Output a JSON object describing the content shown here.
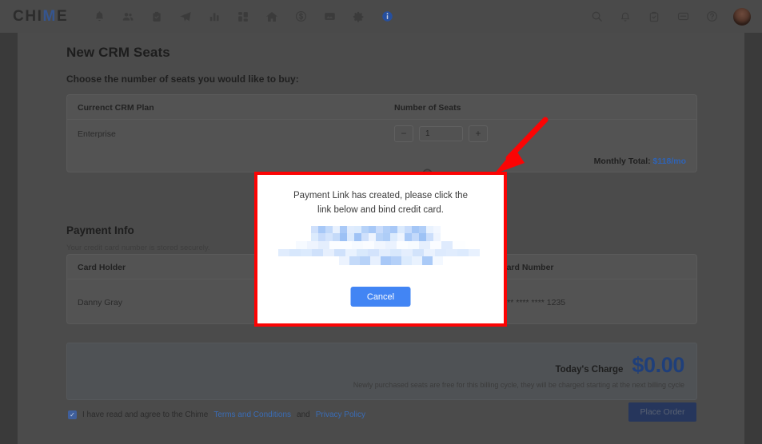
{
  "navbar": {
    "logo": "CHIME",
    "logo_accent_char": "M",
    "left_icons": [
      {
        "name": "bell-icon",
        "label": "Notifications"
      },
      {
        "name": "people-icon",
        "label": "People"
      },
      {
        "name": "clipboard-check-icon",
        "label": "Tasks"
      },
      {
        "name": "paper-plane-icon",
        "label": "Campaigns"
      },
      {
        "name": "bar-chart-icon",
        "label": "Reports"
      },
      {
        "name": "dashboard-grid-icon",
        "label": "Dashboard"
      },
      {
        "name": "home-icon",
        "label": "Listings"
      },
      {
        "name": "dollar-circle-icon",
        "label": "Transactions"
      },
      {
        "name": "image-card-icon",
        "label": "Media"
      },
      {
        "name": "gear-icon",
        "label": "Settings"
      },
      {
        "name": "info-badge-icon",
        "label": "Info"
      }
    ],
    "right_icons": [
      {
        "name": "search-icon",
        "label": "Search"
      },
      {
        "name": "bell-icon",
        "label": "Alerts"
      },
      {
        "name": "clipboard-check-icon",
        "label": "To-dos"
      },
      {
        "name": "chat-icon",
        "label": "Messages"
      },
      {
        "name": "help-circle-icon",
        "label": "Help"
      }
    ],
    "avatar_label": "User avatar"
  },
  "page": {
    "title": "New CRM Seats",
    "subtitle": "Choose the number of seats you would like to buy:"
  },
  "seats_table": {
    "headers": [
      "Currenct CRM Plan",
      "Number of Seats"
    ],
    "plan": "Enterprise",
    "quantity": "1",
    "decrement_label": "−",
    "increment_label": "+",
    "monthly_total_label": "Monthly Total:",
    "monthly_total_value": "$118/mo"
  },
  "payment": {
    "section_title": "Payment Info",
    "note": "Your credit card number is stored securely.",
    "headers": [
      "Card Holder",
      "",
      "Card Number"
    ],
    "card_holder": "Danny Gray",
    "card_number": "**** **** **** 1235"
  },
  "charge": {
    "label": "Today's Charge",
    "amount": "$0.00",
    "note": "Newly purchased seats are free for this  billing cycle, they will be charged starting at the next billing cycle"
  },
  "footer": {
    "agree_prefix": "I have read and agree to the Chime",
    "terms_link": "Terms and Conditions",
    "and_text": "and",
    "privacy_link": "Privacy Policy",
    "period": ".",
    "checkbox_checked": true,
    "checkmark": "✓",
    "place_order_label": "Place Order"
  },
  "modal": {
    "message_line1": "Payment Link has created,  please click the",
    "message_line2": "link below and bind credit card.",
    "link_redacted": true,
    "cancel_label": "Cancel",
    "highlight_color": "#fb0404",
    "button_color": "#4285f4"
  },
  "annotation": {
    "arrow_color": "#fb0404",
    "arrow_points_to": "modal-top-right-corner"
  },
  "colors": {
    "accent_blue": "#2f63b5",
    "charge_blue": "#1f3f7a",
    "link_blue": "#3a6cb5",
    "primary_button": "#26365c"
  }
}
